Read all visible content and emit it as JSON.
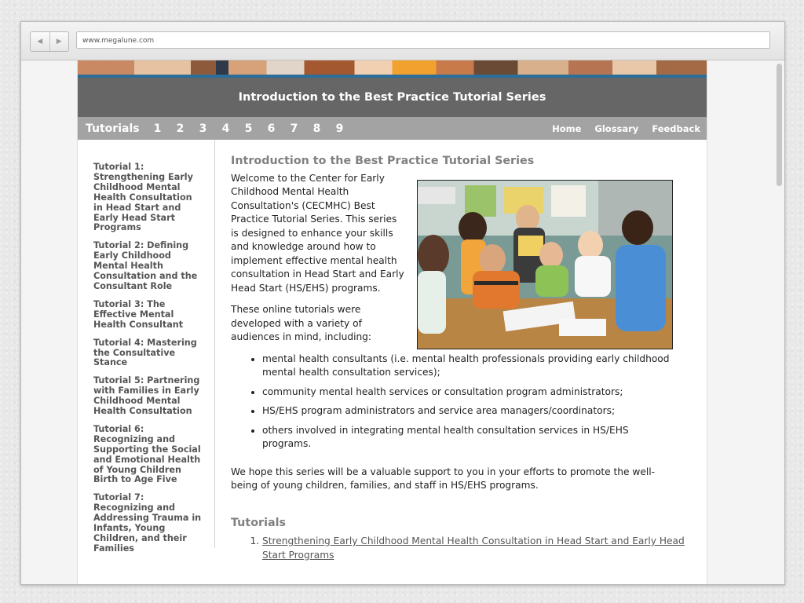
{
  "browser": {
    "url": "www.megalune.com"
  },
  "site": {
    "banner_title": "Introduction to the Best Practice Tutorial Series",
    "nav": {
      "label": "Tutorials",
      "numbers": [
        "1",
        "2",
        "3",
        "4",
        "5",
        "6",
        "7",
        "8",
        "9"
      ],
      "right_links": [
        "Home",
        "Glossary",
        "Feedback"
      ]
    },
    "sidebar": {
      "items": [
        "Tutorial 1: Strengthening Early Childhood Mental Health Consultation in Head Start and Early Head Start Programs",
        "Tutorial 2: Defining Early Childhood Mental Health Consultation and the Consultant Role",
        "Tutorial 3: The Effective Mental Health Consultant",
        "Tutorial 4: Mastering the Consultative Stance",
        "Tutorial 5: Partnering with Families in Early Childhood Mental Health Consultation",
        "Tutorial 6: Recognizing and Supporting the Social and Emotional Health of Young Children Birth to Age Five",
        "Tutorial 7: Recognizing and Addressing Trauma in Infants, Young Children, and their Families"
      ]
    },
    "main": {
      "heading": "Introduction to the Best Practice Tutorial Series",
      "intro": "Welcome to the Center for Early Childhood Mental Health Consultation's (CECMHC) Best Practice Tutorial Series. This series is designed to enhance your skills and knowledge around how to implement effective mental health consultation in Head Start and Early Head Start (HS/EHS) programs.",
      "audience_intro": "These online tutorials were developed with a variety of audiences in mind, including:",
      "bullets": [
        "mental health consultants (i.e. mental health professionals providing early childhood mental health consultation services);",
        "community mental health services or consultation program administrators;",
        "HS/EHS program administrators and service area managers/coordinators;",
        "others involved in integrating mental health consultation services in HS/EHS programs."
      ],
      "closing": "We hope this series will be a valuable support to you in your efforts to promote the well-being of young children, families, and staff in HS/EHS programs.",
      "tutorials_heading": "Tutorials",
      "tutorial_links": [
        "Strengthening Early Childhood Mental Health Consultation in Head Start and Early Head Start Programs"
      ]
    }
  },
  "colors": {
    "title_bar": "#666666",
    "nav_bar": "#a3a3a3",
    "accent_line": "#2b6e99",
    "heading_gray": "#808080"
  }
}
